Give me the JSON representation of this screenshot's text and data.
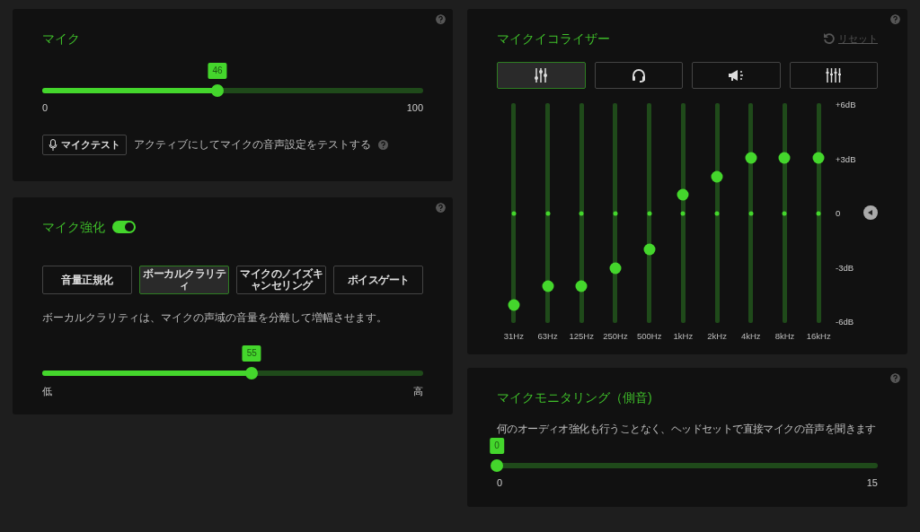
{
  "mic": {
    "title": "マイク",
    "volume": {
      "value": "46",
      "level": 0.46,
      "min": "0",
      "max": "100"
    },
    "test_button": "マイクテスト",
    "test_description": "アクティブにしてマイクの音声設定をテストする"
  },
  "enhancement": {
    "title": "マイク強化",
    "on": true,
    "options": [
      {
        "label": "音量正規化",
        "selected": false
      },
      {
        "label": "ボーカルクラリティ",
        "selected": true
      },
      {
        "label": "マイクのノイズキャンセリング",
        "selected": false
      },
      {
        "label": "ボイスゲート",
        "selected": false
      }
    ],
    "description": "ボーカルクラリティは、マイクの声域の音量を分離して増幅させます。",
    "strength": {
      "value": "55",
      "level": 0.55,
      "min": "低",
      "max": "高"
    }
  },
  "equalizer": {
    "title": "マイクイコライザー",
    "reset": "リセット",
    "presets": [
      {
        "kind": "sliders",
        "selected": true
      },
      {
        "kind": "headset",
        "selected": false
      },
      {
        "kind": "megaphone",
        "selected": false
      },
      {
        "kind": "equalizer",
        "selected": false
      }
    ],
    "bands": [
      {
        "label": "31Hz",
        "level": 0.083
      },
      {
        "label": "63Hz",
        "level": 0.167
      },
      {
        "label": "125Hz",
        "level": 0.167
      },
      {
        "label": "250Hz",
        "level": 0.25
      },
      {
        "label": "500Hz",
        "level": 0.333
      },
      {
        "label": "1kHz",
        "level": 0.583
      },
      {
        "label": "2kHz",
        "level": 0.667
      },
      {
        "label": "4kHz",
        "level": 0.75
      },
      {
        "label": "8kHz",
        "level": 0.75
      },
      {
        "label": "16kHz",
        "level": 0.75
      }
    ],
    "scale": [
      "+6dB",
      "+3dB",
      "0",
      "-3dB",
      "-6dB"
    ]
  },
  "monitoring": {
    "title": "マイクモニタリング（側音)",
    "description": "何のオーディオ強化も行うことなく、ヘッドセットで直接マイクの音声を聞きます",
    "sidetone": {
      "value": "0",
      "level": 0,
      "min": "0",
      "max": "15"
    }
  }
}
